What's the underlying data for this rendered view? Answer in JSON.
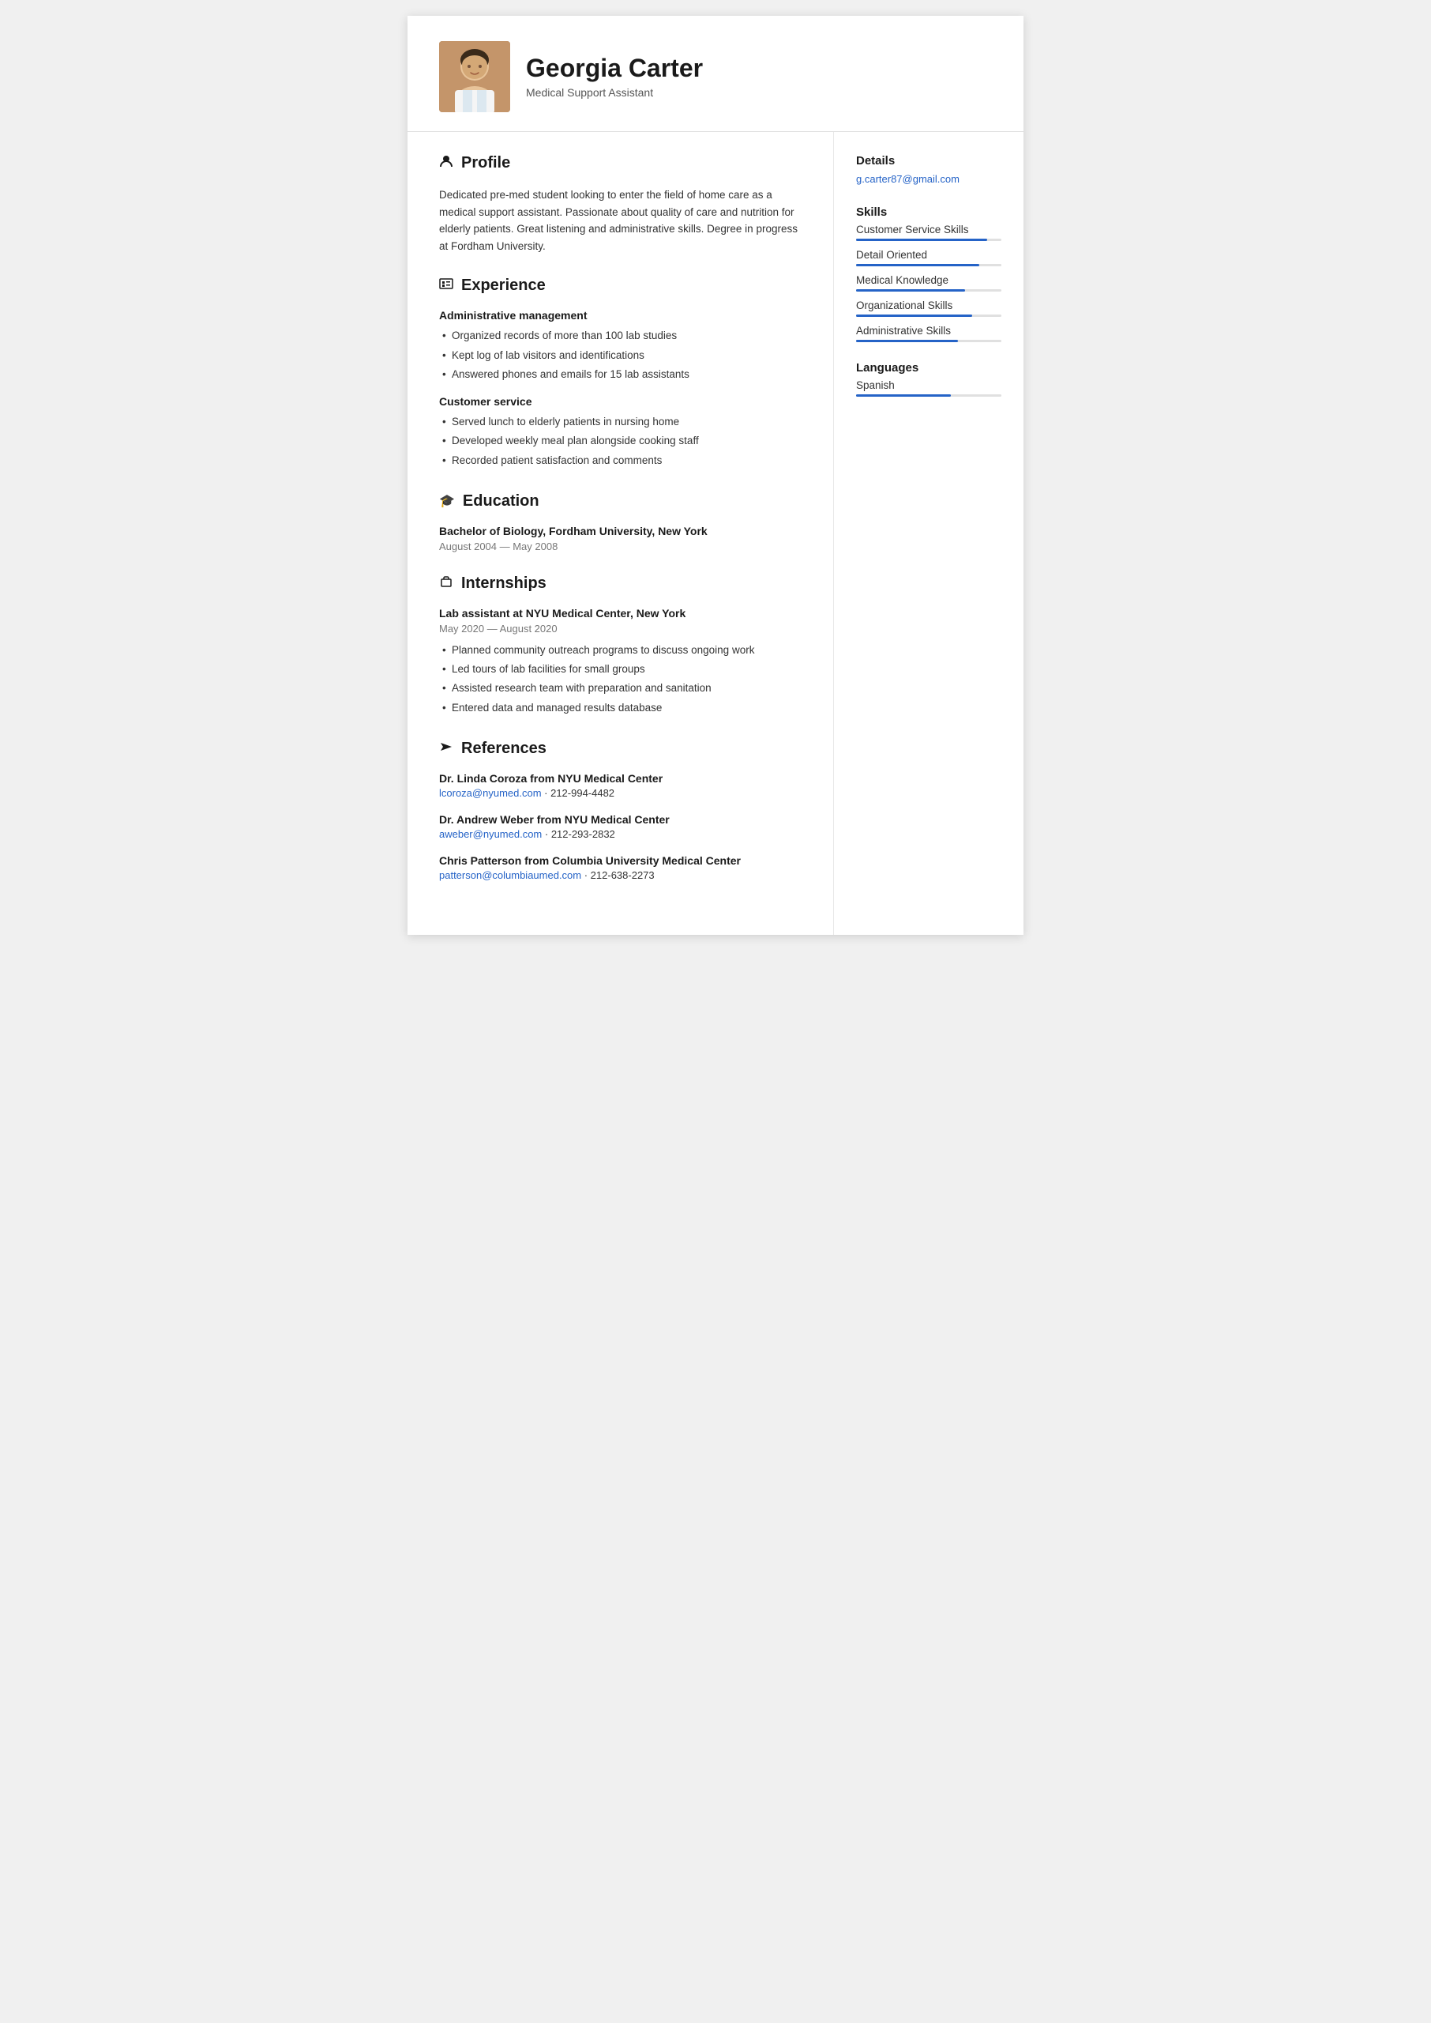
{
  "header": {
    "name": "Georgia Carter",
    "title": "Medical Support Assistant",
    "avatar_alt": "Georgia Carter photo"
  },
  "profile": {
    "section_title": "Profile",
    "icon": "👤",
    "text": "Dedicated pre-med student looking to enter the field of home care as a medical support assistant. Passionate about quality of care and nutrition for elderly patients. Great listening and administrative skills. Degree in progress at Fordham University."
  },
  "experience": {
    "section_title": "Experience",
    "icon": "▦",
    "jobs": [
      {
        "title": "Administrative management",
        "bullets": [
          "Organized records of more than 100 lab studies",
          "Kept log of lab visitors and identifications",
          "Answered phones and emails for 15 lab assistants"
        ]
      },
      {
        "title": "Customer service",
        "bullets": [
          "Served lunch to elderly patients in nursing home",
          "Developed weekly meal plan alongside cooking staff",
          "Recorded patient satisfaction and comments"
        ]
      }
    ]
  },
  "education": {
    "section_title": "Education",
    "icon": "🎓",
    "degree": "Bachelor of Biology, Fordham University, New York",
    "dates": "August 2004 — May 2008"
  },
  "internships": {
    "section_title": "Internships",
    "icon": "💼",
    "title": "Lab assistant at NYU Medical Center, New York",
    "dates": "May 2020 — August 2020",
    "bullets": [
      "Planned community outreach programs to discuss ongoing work",
      "Led tours of lab facilities for small groups",
      "Assisted research team with preparation and sanitation",
      "Entered data and managed results database"
    ]
  },
  "references": {
    "section_title": "References",
    "icon": "📢",
    "refs": [
      {
        "name": "Dr. Linda Coroza from NYU Medical Center",
        "email": "lcoroza@nyumed.com",
        "phone": "212-994-4482"
      },
      {
        "name": "Dr. Andrew Weber from NYU Medical Center",
        "email": "aweber@nyumed.com",
        "phone": "212-293-2832"
      },
      {
        "name": "Chris Patterson from Columbia University Medical Center",
        "email": "patterson@columbiaumed.com",
        "phone": "212-638-2273"
      }
    ]
  },
  "details": {
    "section_title": "Details",
    "email": "g.carter87@gmail.com"
  },
  "skills": {
    "section_title": "Skills",
    "items": [
      {
        "name": "Customer Service Skills",
        "level": 90
      },
      {
        "name": "Detail Oriented",
        "level": 85
      },
      {
        "name": "Medical Knowledge",
        "level": 75
      },
      {
        "name": "Organizational Skills",
        "level": 80
      },
      {
        "name": "Administrative Skills",
        "level": 70
      }
    ]
  },
  "languages": {
    "section_title": "Languages",
    "items": [
      {
        "name": "Spanish",
        "level": 65
      }
    ]
  }
}
